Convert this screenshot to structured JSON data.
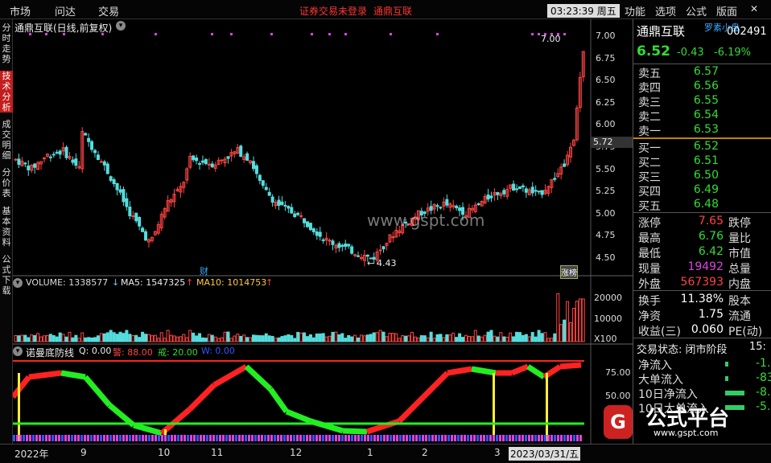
{
  "menu": {
    "items": [
      "市场",
      "问达",
      "交易"
    ],
    "alert": "证券交易未登录",
    "stock_name": "通鼎互联",
    "time": "03:23:39 周五",
    "right_items": [
      "功能",
      "选项",
      "公式",
      "版面"
    ]
  },
  "sidebar": {
    "items": [
      "分时走势",
      "技术分析",
      "成交明细",
      "分价表",
      "基本资料",
      "公式下载"
    ]
  },
  "main_chart": {
    "title": "通鼎互联(日线,前复权)",
    "y_ticks": [
      "7.00",
      "6.75",
      "6.50",
      "6.25",
      "6.00",
      "5.75",
      "5.50",
      "5.25",
      "5.00",
      "4.75",
      "4.50"
    ],
    "high_label": "7.00",
    "low_label": "4.43",
    "current_price_label": "5.72",
    "marker_cai": "财",
    "marker_zhangbang": "涨榜"
  },
  "volume": {
    "label": "VOLUME: 1338577",
    "ma5": "MA5: 1547325",
    "ma10": "MA10: 1014753",
    "y_ticks": [
      "20000",
      "10000",
      "X100"
    ]
  },
  "indicator": {
    "name": "诺曼底防线",
    "q": "Q: 0.00",
    "jing": "警: 88.00",
    "jie": "戒: 20.00",
    "w": "W: 0.00",
    "y_ticks": [
      "75.00",
      "50.00"
    ]
  },
  "quote": {
    "name": "通鼎互联",
    "tag": "罗素小盘",
    "code": "002491",
    "price": "6.52",
    "change": "-0.43",
    "pct": "-6.19%",
    "asks": [
      {
        "label": "卖五",
        "price": "6.57"
      },
      {
        "label": "卖四",
        "price": "6.56"
      },
      {
        "label": "卖三",
        "price": "6.55"
      },
      {
        "label": "卖二",
        "price": "6.54"
      },
      {
        "label": "卖一",
        "price": "6.53"
      }
    ],
    "bids": [
      {
        "label": "买一",
        "price": "6.52"
      },
      {
        "label": "买二",
        "price": "6.51"
      },
      {
        "label": "买三",
        "price": "6.50"
      },
      {
        "label": "买四",
        "price": "6.49"
      },
      {
        "label": "买五",
        "price": "6.48"
      }
    ],
    "stats": [
      {
        "label": "涨停",
        "value": "7.65",
        "right": "跌停",
        "color": "#ff4444"
      },
      {
        "label": "最高",
        "value": "6.76",
        "right": "量比",
        "color": "#33dd33"
      },
      {
        "label": "最低",
        "value": "6.42",
        "right": "市值",
        "color": "#33dd33"
      },
      {
        "label": "现量",
        "value": "19492",
        "right": "总量",
        "color": "#dd44dd"
      },
      {
        "label": "外盘",
        "value": "567393",
        "right": "内盘",
        "color": "#ff4444"
      }
    ],
    "stats2": [
      {
        "label": "换手",
        "value": "11.38%",
        "right": "股本"
      },
      {
        "label": "净资",
        "value": "1.75",
        "right": "流通"
      },
      {
        "label": "收益(三)",
        "value": "0.060",
        "right": "PE(动)"
      }
    ],
    "trade_status": "交易状态: 闭市阶段",
    "trade_time": "15:",
    "flows": [
      {
        "label": "净流入",
        "value": "-1."
      },
      {
        "label": "大单流入",
        "value": "-83"
      },
      {
        "label": "10日净流入",
        "value": "-8."
      },
      {
        "label": "10日大单流入",
        "value": "-5."
      }
    ]
  },
  "watermarks": {
    "center": "www.gspt.com",
    "logo_text": "公式平台",
    "logo_url": "www.gspt.com"
  },
  "x_axis": {
    "labels": [
      "2022年",
      "9",
      "10",
      "11",
      "12",
      "1",
      "2",
      "3",
      "2023/03/31/五",
      "4"
    ]
  }
}
